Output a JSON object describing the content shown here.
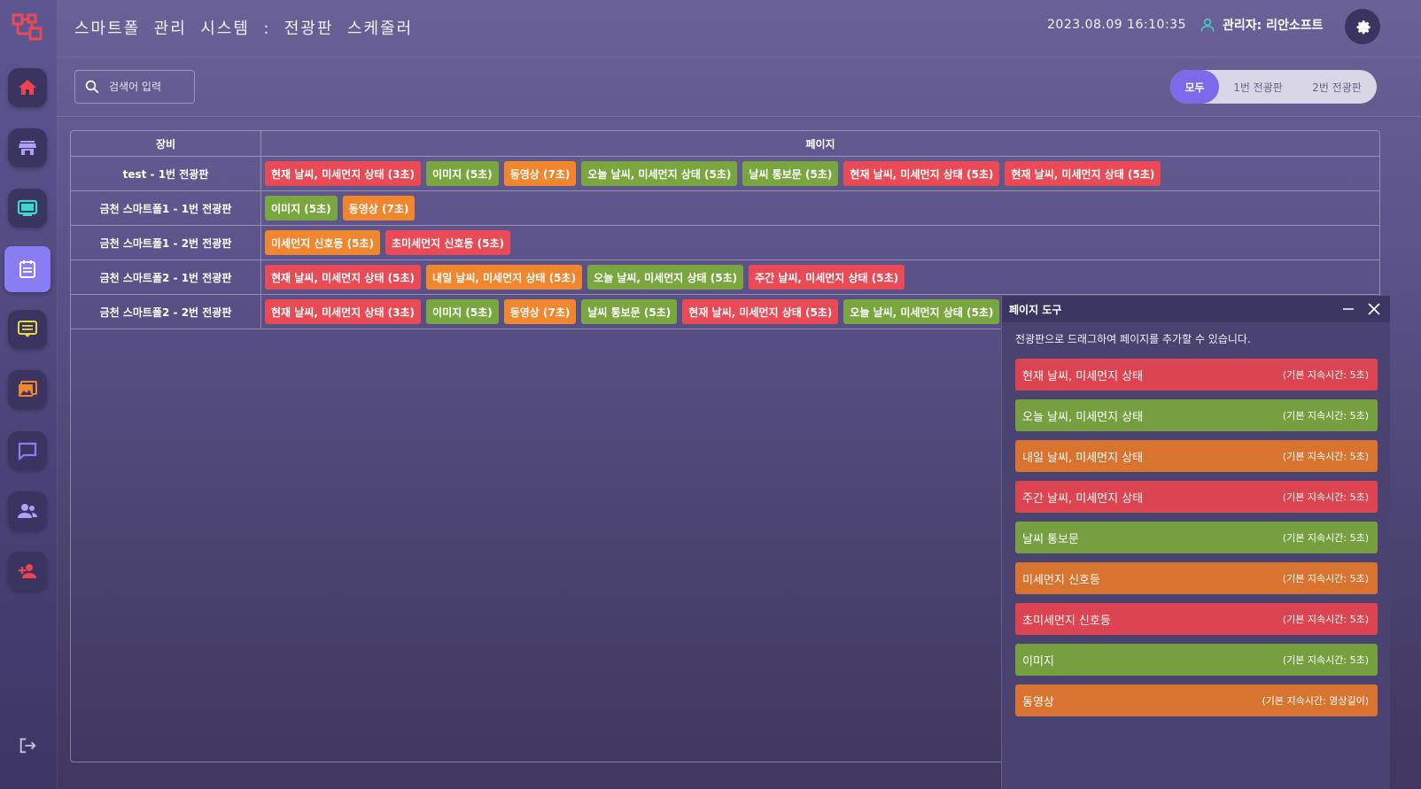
{
  "header": {
    "title": "스마트폴  관리  시스템  :  전광판  스케줄러",
    "datetime": "2023.08.09 16:10:35",
    "user": "관리자: 리안소프트"
  },
  "sidebar": {
    "items": [
      {
        "icon": "home-icon"
      },
      {
        "icon": "store-icon"
      },
      {
        "icon": "monitor-icon"
      },
      {
        "icon": "schedule-icon",
        "active": true
      },
      {
        "icon": "message-board-icon"
      },
      {
        "icon": "media-library-icon"
      },
      {
        "icon": "chat-icon"
      },
      {
        "icon": "group-icon"
      },
      {
        "icon": "add-user-icon"
      }
    ],
    "logout_icon": "logout-icon"
  },
  "search": {
    "placeholder": "검색어 입력"
  },
  "filter": {
    "options": [
      "모두",
      "1번 전광판",
      "2번 전광판"
    ],
    "selected": "모두"
  },
  "table": {
    "headers": {
      "device": "장비",
      "pages": "페이지"
    },
    "rows": [
      {
        "device": "test - 1번 전광판",
        "pages": [
          {
            "label": "현재 날씨, 미세먼지 상태 (3초)",
            "color": "red"
          },
          {
            "label": "이미지 (5초)",
            "color": "green"
          },
          {
            "label": "동영상 (7초)",
            "color": "orange"
          },
          {
            "label": "오늘 날씨, 미세먼지 상태 (5초)",
            "color": "green"
          },
          {
            "label": "날씨 통보문 (5초)",
            "color": "green"
          },
          {
            "label": "현재 날씨, 미세먼지 상태 (5초)",
            "color": "red"
          },
          {
            "label": "현재 날씨, 미세먼지 상태 (5초)",
            "color": "red"
          }
        ]
      },
      {
        "device": "금천 스마트폴1 - 1번 전광판",
        "pages": [
          {
            "label": "이미지 (5초)",
            "color": "green"
          },
          {
            "label": "동영상 (7초)",
            "color": "orange"
          }
        ]
      },
      {
        "device": "금천 스마트폴1 - 2번 전광판",
        "pages": [
          {
            "label": "미세먼지 신호등 (5초)",
            "color": "orange"
          },
          {
            "label": "초미세먼지 신호등 (5초)",
            "color": "red"
          }
        ]
      },
      {
        "device": "금천 스마트폴2 - 1번 전광판",
        "pages": [
          {
            "label": "현재 날씨, 미세먼지 상태 (5초)",
            "color": "red"
          },
          {
            "label": "내일 날씨, 미세먼지 상태 (5초)",
            "color": "orange"
          },
          {
            "label": "오늘 날씨, 미세먼지 상태 (5초)",
            "color": "green"
          },
          {
            "label": "주간 날씨, 미세먼지 상태 (5초)",
            "color": "red"
          }
        ]
      },
      {
        "device": "금천 스마트폴2 - 2번 전광판",
        "pages": [
          {
            "label": "현재 날씨, 미세먼지 상태 (3초)",
            "color": "red"
          },
          {
            "label": "이미지 (5초)",
            "color": "green"
          },
          {
            "label": "동영상 (7초)",
            "color": "orange"
          },
          {
            "label": "날씨 통보문 (5초)",
            "color": "green"
          },
          {
            "label": "현재 날씨, 미세먼지 상태 (5초)",
            "color": "red"
          },
          {
            "label": "오늘 날씨, 미세먼지 상태 (5초)",
            "color": "green"
          }
        ]
      }
    ]
  },
  "panel": {
    "title": "페이지 도구",
    "description": "전광판으로 드래그하여 페이지를 추가할 수 있습니다.",
    "items": [
      {
        "name": "현재 날씨, 미세먼지 상태",
        "duration": "(기본 지속시간: 5초)",
        "color": "red"
      },
      {
        "name": "오늘 날씨, 미세먼지 상태",
        "duration": "(기본 지속시간: 5초)",
        "color": "green"
      },
      {
        "name": "내일 날씨, 미세먼지 상태",
        "duration": "(기본 지속시간: 5초)",
        "color": "orange"
      },
      {
        "name": "주간 날씨, 미세먼지 상태",
        "duration": "(기본 지속시간: 5초)",
        "color": "red"
      },
      {
        "name": "날씨 통보문",
        "duration": "(기본 지속시간: 5초)",
        "color": "green"
      },
      {
        "name": "미세먼지 신호등",
        "duration": "(기본 지속시간: 5초)",
        "color": "orange"
      },
      {
        "name": "초미세먼지 신호등",
        "duration": "(기본 지속시간: 5초)",
        "color": "red"
      },
      {
        "name": "이미지",
        "duration": "(기본 지속시간: 5초)",
        "color": "green"
      },
      {
        "name": "동영상",
        "duration": "(기본 지속시간: 영상길이)",
        "color": "orange"
      }
    ]
  },
  "colors": {
    "red": "#e84b55",
    "green": "#79a63f",
    "orange": "#f0862d",
    "accent": "#7b6bea"
  }
}
